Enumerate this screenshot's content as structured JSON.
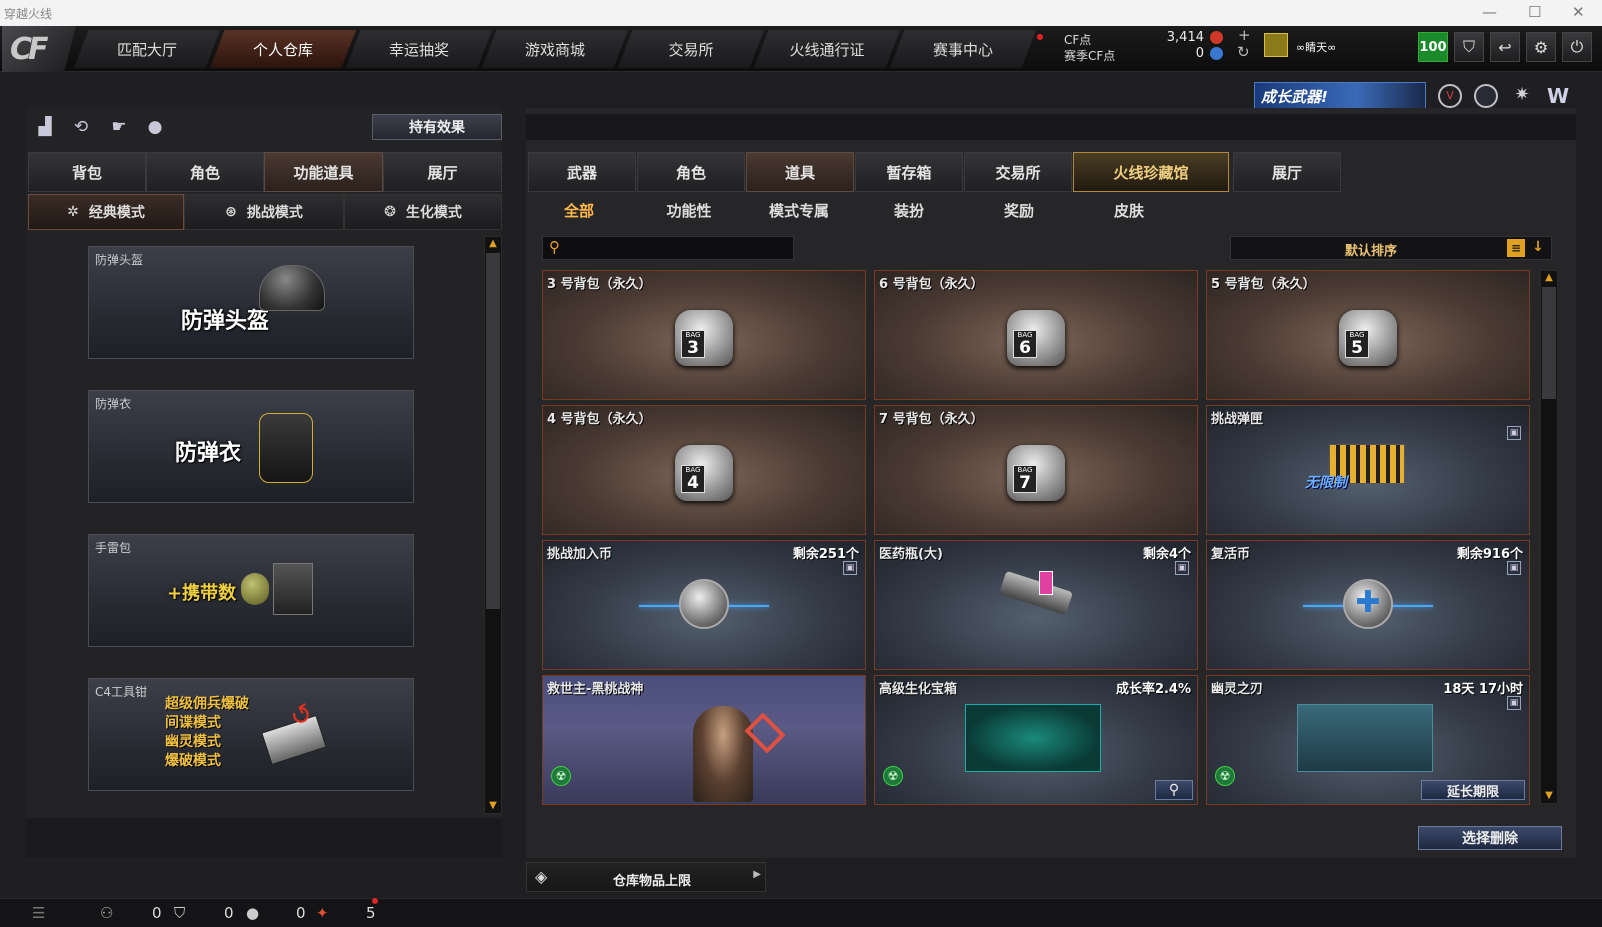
{
  "window": {
    "title": "穿越火线",
    "minimize": "—",
    "maximize": "☐",
    "close": "✕"
  },
  "nav": {
    "logo": "CF",
    "tabs": [
      "匹配大厅",
      "个人仓库",
      "幸运抽奖",
      "游戏商城",
      "交易所",
      "火线通行证",
      "赛事中心"
    ],
    "active_tab": "个人仓库"
  },
  "currency": {
    "cf_label": "CF点",
    "cf_value": "3,414",
    "season_label": "赛季CF点",
    "season_value": "0",
    "add": "+",
    "refresh": "↻"
  },
  "user": {
    "name": "∞睛天∞",
    "level_badge": "100"
  },
  "system_buttons": [
    "shield-icon",
    "back-icon",
    "gear-icon",
    "power-icon"
  ],
  "promo": {
    "banner_text": "成长武器!"
  },
  "left": {
    "effect_button": "持有效果",
    "tabs": [
      "背包",
      "角色",
      "功能道具",
      "展厅"
    ],
    "active_tab": "功能道具",
    "modes": [
      "经典模式",
      "挑战模式",
      "生化模式"
    ],
    "active_mode": "经典模式",
    "cards": [
      {
        "name": "防弹头盔",
        "big": "防弹头盔"
      },
      {
        "name": "防弹衣",
        "big": "防弹衣"
      },
      {
        "name": "手雷包",
        "big": "+携带数"
      },
      {
        "name": "C4工具钳",
        "lines": [
          "超级佣兵爆破",
          "间谍模式",
          "幽灵模式",
          "爆破模式"
        ]
      }
    ]
  },
  "right": {
    "tabs": [
      "武器",
      "角色",
      "道具",
      "暂存箱",
      "交易所",
      "火线珍藏馆",
      "展厅"
    ],
    "active_tab": "道具",
    "highlight_tab": "火线珍藏馆",
    "subtabs": [
      "全部",
      "功能性",
      "模式专属",
      "装扮",
      "奖励",
      "皮肤"
    ],
    "active_subtab": "全部",
    "search_placeholder": "",
    "sort_label": "默认排序",
    "items": [
      {
        "name": "3 号背包（永久）",
        "right": "",
        "bag": "3"
      },
      {
        "name": "6 号背包（永久）",
        "right": "",
        "bag": "6"
      },
      {
        "name": "5 号背包（永久）",
        "right": "",
        "bag": "5"
      },
      {
        "name": "4 号背包（永久）",
        "right": "",
        "bag": "4"
      },
      {
        "name": "7 号背包（永久）",
        "right": "",
        "bag": "7"
      },
      {
        "name": "挑战弹匣",
        "right": "",
        "badge": "无限制"
      },
      {
        "name": "挑战加入币",
        "right": "剩余251个"
      },
      {
        "name": "医药瓶(大)",
        "right": "剩余4个"
      },
      {
        "name": "复活币",
        "right": "剩余916个"
      },
      {
        "name": "救世主-黑桃战神",
        "right": ""
      },
      {
        "name": "高级生化宝箱",
        "right": "成长率2.4%"
      },
      {
        "name": "幽灵之刃",
        "right": "18天 17小时",
        "button": "延长期限"
      }
    ],
    "select_delete": "选择删除",
    "storage_limit": "仓库物品上限"
  },
  "bottom": {
    "counts": [
      "0",
      "0",
      "0",
      "5"
    ]
  }
}
